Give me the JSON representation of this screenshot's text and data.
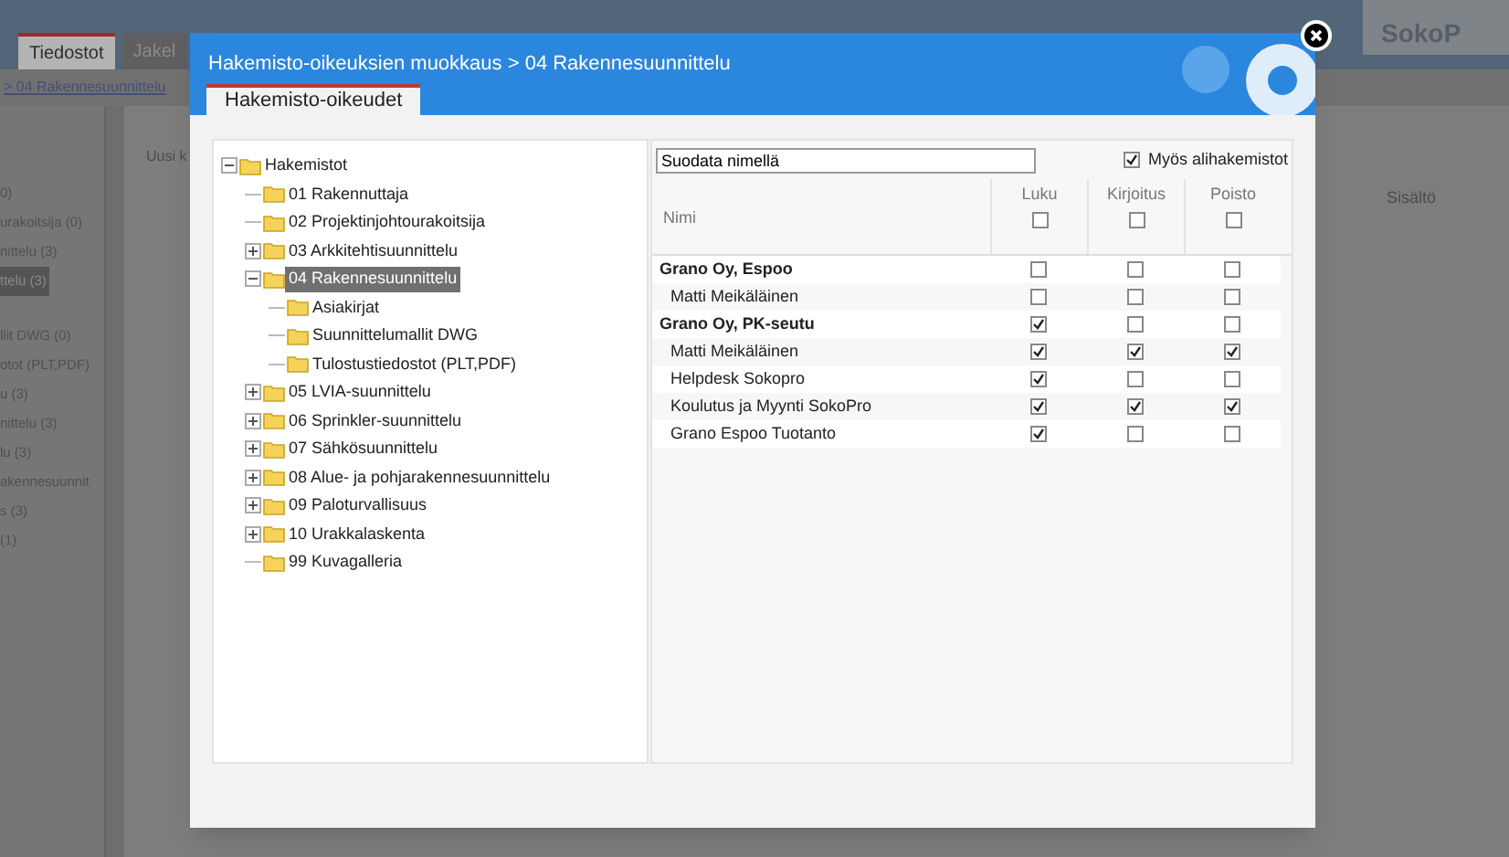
{
  "background": {
    "tabs": [
      {
        "label": "Tiedostot",
        "selected": true
      },
      {
        "label": "Jakel",
        "selected": false
      }
    ],
    "logo": "SokoP",
    "breadcrumb": "> 04 Rakennesuunnittelu",
    "folders": [
      {
        "label": "0)",
        "selected": false
      },
      {
        "label": "urakoitsija (0)",
        "selected": false
      },
      {
        "label": "nittelu (3)",
        "selected": false
      },
      {
        "label": "ttelu (3)",
        "selected": true
      },
      {
        "label": "llit DWG (0)",
        "selected": false
      },
      {
        "label": "otot (PLT,PDF)",
        "selected": false
      },
      {
        "label": "u (3)",
        "selected": false
      },
      {
        "label": "nittelu (3)",
        "selected": false
      },
      {
        "label": "lu (3)",
        "selected": false
      },
      {
        "label": "akennesuunnit",
        "selected": false
      },
      {
        "label": "s (3)",
        "selected": false
      },
      {
        "label": "(1)",
        "selected": false
      }
    ],
    "new_label": "Uusi k",
    "column": "Sisältö"
  },
  "dialog": {
    "title": "Hakemisto-oikeuksien muokkaus > 04 Rakennesuunnittelu",
    "tabs": [
      {
        "label": "Hakemisto-oikeudet",
        "selected": true
      }
    ],
    "tree": {
      "label": "Hakemistot",
      "expanded": true,
      "selected": false,
      "children": [
        {
          "label": "01 Rakennuttaja",
          "selected": false
        },
        {
          "label": "02 Projektinjohtourakoitsija",
          "selected": false
        },
        {
          "label": "03 Arkkitehtisuunnittelu",
          "expanded": false,
          "selected": false
        },
        {
          "label": "04 Rakennesuunnittelu",
          "expanded": true,
          "selected": true,
          "children": [
            {
              "label": "Asiakirjat",
              "selected": false
            },
            {
              "label": "Suunnittelumallit DWG",
              "selected": false
            },
            {
              "label": "Tulostustiedostot (PLT,PDF)",
              "selected": false
            }
          ]
        },
        {
          "label": "05 LVIA-suunnittelu",
          "expanded": false,
          "selected": false
        },
        {
          "label": "06 Sprinkler-suunnittelu",
          "expanded": false,
          "selected": false
        },
        {
          "label": "07 Sähkösuunnittelu",
          "expanded": false,
          "selected": false
        },
        {
          "label": "08 Alue- ja pohjarakennesuunnittelu",
          "expanded": false,
          "selected": false
        },
        {
          "label": "09 Paloturvallisuus",
          "expanded": false,
          "selected": false
        },
        {
          "label": "10 Urakkalaskenta",
          "expanded": false,
          "selected": false
        },
        {
          "label": "99 Kuvagalleria",
          "selected": false
        }
      ]
    },
    "filter": {
      "value": "Suodata nimellä"
    },
    "include_subfolders": {
      "label": "Myös alihakemistot",
      "checked": true
    },
    "columns": [
      {
        "label": "Nimi"
      },
      {
        "label": "Luku",
        "checked": false
      },
      {
        "label": "Kirjoitus",
        "checked": false
      },
      {
        "label": "Poisto",
        "checked": false
      }
    ],
    "rows": [
      {
        "kind": "group",
        "name": "Grano Oy, Espoo",
        "read": false,
        "write": false,
        "delete": false
      },
      {
        "kind": "member",
        "name": "Matti Meikäläinen",
        "read": false,
        "write": false,
        "delete": false
      },
      {
        "kind": "group",
        "name": "Grano Oy, PK-seutu",
        "read": true,
        "write": false,
        "delete": false
      },
      {
        "kind": "member",
        "name": "Matti Meikäläinen",
        "read": true,
        "write": true,
        "delete": true
      },
      {
        "kind": "member",
        "name": "Helpdesk Sokopro",
        "read": true,
        "write": false,
        "delete": false
      },
      {
        "kind": "member",
        "name": "Koulutus ja Myynti SokoPro",
        "read": true,
        "write": true,
        "delete": true
      },
      {
        "kind": "member",
        "name": "Grano Espoo Tuotanto",
        "read": true,
        "write": false,
        "delete": false
      }
    ]
  }
}
